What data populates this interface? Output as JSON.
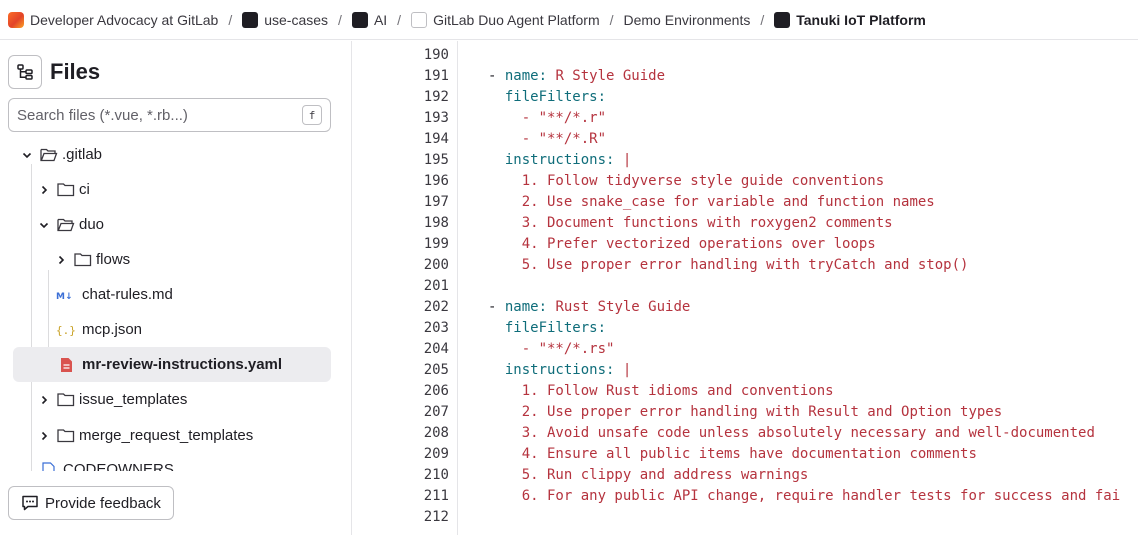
{
  "breadcrumb": [
    {
      "label": "Developer Advocacy at GitLab",
      "icon": "gitlab-group-avatar-icon"
    },
    {
      "label": "use-cases",
      "icon": "project-avatar-icon"
    },
    {
      "label": "AI",
      "icon": "project-avatar-icon"
    },
    {
      "label": "GitLab Duo Agent Platform",
      "icon": "project-avatar-icon"
    },
    {
      "label": "Demo Environments",
      "icon": ""
    },
    {
      "label": "Tanuki IoT Platform",
      "icon": "project-avatar-icon"
    }
  ],
  "sidebar": {
    "title": "Files",
    "search_placeholder": "Search files (*.vue, *.rb...)",
    "search_shortcut": "f",
    "tree": [
      {
        "label": ".gitlab",
        "type": "folder",
        "expanded": true,
        "depth": 0
      },
      {
        "label": "ci",
        "type": "folder",
        "expanded": false,
        "depth": 1
      },
      {
        "label": "duo",
        "type": "folder",
        "expanded": true,
        "depth": 1
      },
      {
        "label": "flows",
        "type": "folder",
        "expanded": false,
        "depth": 2
      },
      {
        "label": "chat-rules.md",
        "type": "markdown",
        "depth": 2
      },
      {
        "label": "mcp.json",
        "type": "json",
        "depth": 2
      },
      {
        "label": "mr-review-instructions.yaml",
        "type": "yaml",
        "depth": 2,
        "selected": true
      },
      {
        "label": "issue_templates",
        "type": "folder",
        "expanded": false,
        "depth": 1
      },
      {
        "label": "merge_request_templates",
        "type": "folder",
        "expanded": false,
        "depth": 1
      },
      {
        "label": "CODEOWNERS",
        "type": "file",
        "depth": 0
      }
    ],
    "feedback_label": "Provide feedback"
  },
  "editor": {
    "lines": [
      {
        "num": "190",
        "indent": "",
        "dash": "",
        "key": "",
        "value": ""
      },
      {
        "num": "191",
        "indent": "",
        "dash": "- ",
        "key": "name:",
        "value": " R Style Guide"
      },
      {
        "num": "192",
        "indent": "  ",
        "dash": "",
        "key": "fileFilters:",
        "value": ""
      },
      {
        "num": "193",
        "indent": "    ",
        "dash": "",
        "key": "",
        "value": "- \"**/*.r\""
      },
      {
        "num": "194",
        "indent": "    ",
        "dash": "",
        "key": "",
        "value": "- \"**/*.R\""
      },
      {
        "num": "195",
        "indent": "  ",
        "dash": "",
        "key": "instructions:",
        "value": " |"
      },
      {
        "num": "196",
        "indent": "    ",
        "dash": "",
        "key": "",
        "value": "1. Follow tidyverse style guide conventions"
      },
      {
        "num": "197",
        "indent": "    ",
        "dash": "",
        "key": "",
        "value": "2. Use snake_case for variable and function names"
      },
      {
        "num": "198",
        "indent": "    ",
        "dash": "",
        "key": "",
        "value": "3. Document functions with roxygen2 comments"
      },
      {
        "num": "199",
        "indent": "    ",
        "dash": "",
        "key": "",
        "value": "4. Prefer vectorized operations over loops"
      },
      {
        "num": "200",
        "indent": "    ",
        "dash": "",
        "key": "",
        "value": "5. Use proper error handling with tryCatch and stop()"
      },
      {
        "num": "201",
        "indent": "",
        "dash": "",
        "key": "",
        "value": ""
      },
      {
        "num": "202",
        "indent": "",
        "dash": "- ",
        "key": "name:",
        "value": " Rust Style Guide"
      },
      {
        "num": "203",
        "indent": "  ",
        "dash": "",
        "key": "fileFilters:",
        "value": ""
      },
      {
        "num": "204",
        "indent": "    ",
        "dash": "",
        "key": "",
        "value": "- \"**/*.rs\""
      },
      {
        "num": "205",
        "indent": "  ",
        "dash": "",
        "key": "instructions:",
        "value": " |"
      },
      {
        "num": "206",
        "indent": "    ",
        "dash": "",
        "key": "",
        "value": "1. Follow Rust idioms and conventions"
      },
      {
        "num": "207",
        "indent": "    ",
        "dash": "",
        "key": "",
        "value": "2. Use proper error handling with Result and Option types"
      },
      {
        "num": "208",
        "indent": "    ",
        "dash": "",
        "key": "",
        "value": "3. Avoid unsafe code unless absolutely necessary and well-documented"
      },
      {
        "num": "209",
        "indent": "    ",
        "dash": "",
        "key": "",
        "value": "4. Ensure all public items have documentation comments"
      },
      {
        "num": "210",
        "indent": "    ",
        "dash": "",
        "key": "",
        "value": "5. Run clippy and address warnings"
      },
      {
        "num": "211",
        "indent": "    ",
        "dash": "",
        "key": "",
        "value": "6. For any public API change, require handler tests for success and fai"
      },
      {
        "num": "212",
        "indent": "",
        "dash": "",
        "key": "",
        "value": ""
      }
    ]
  },
  "colors": {
    "key": "#0f6d7a",
    "value": "#b5333e",
    "selected_row": "#ececef",
    "border": "#e5e5e8"
  }
}
